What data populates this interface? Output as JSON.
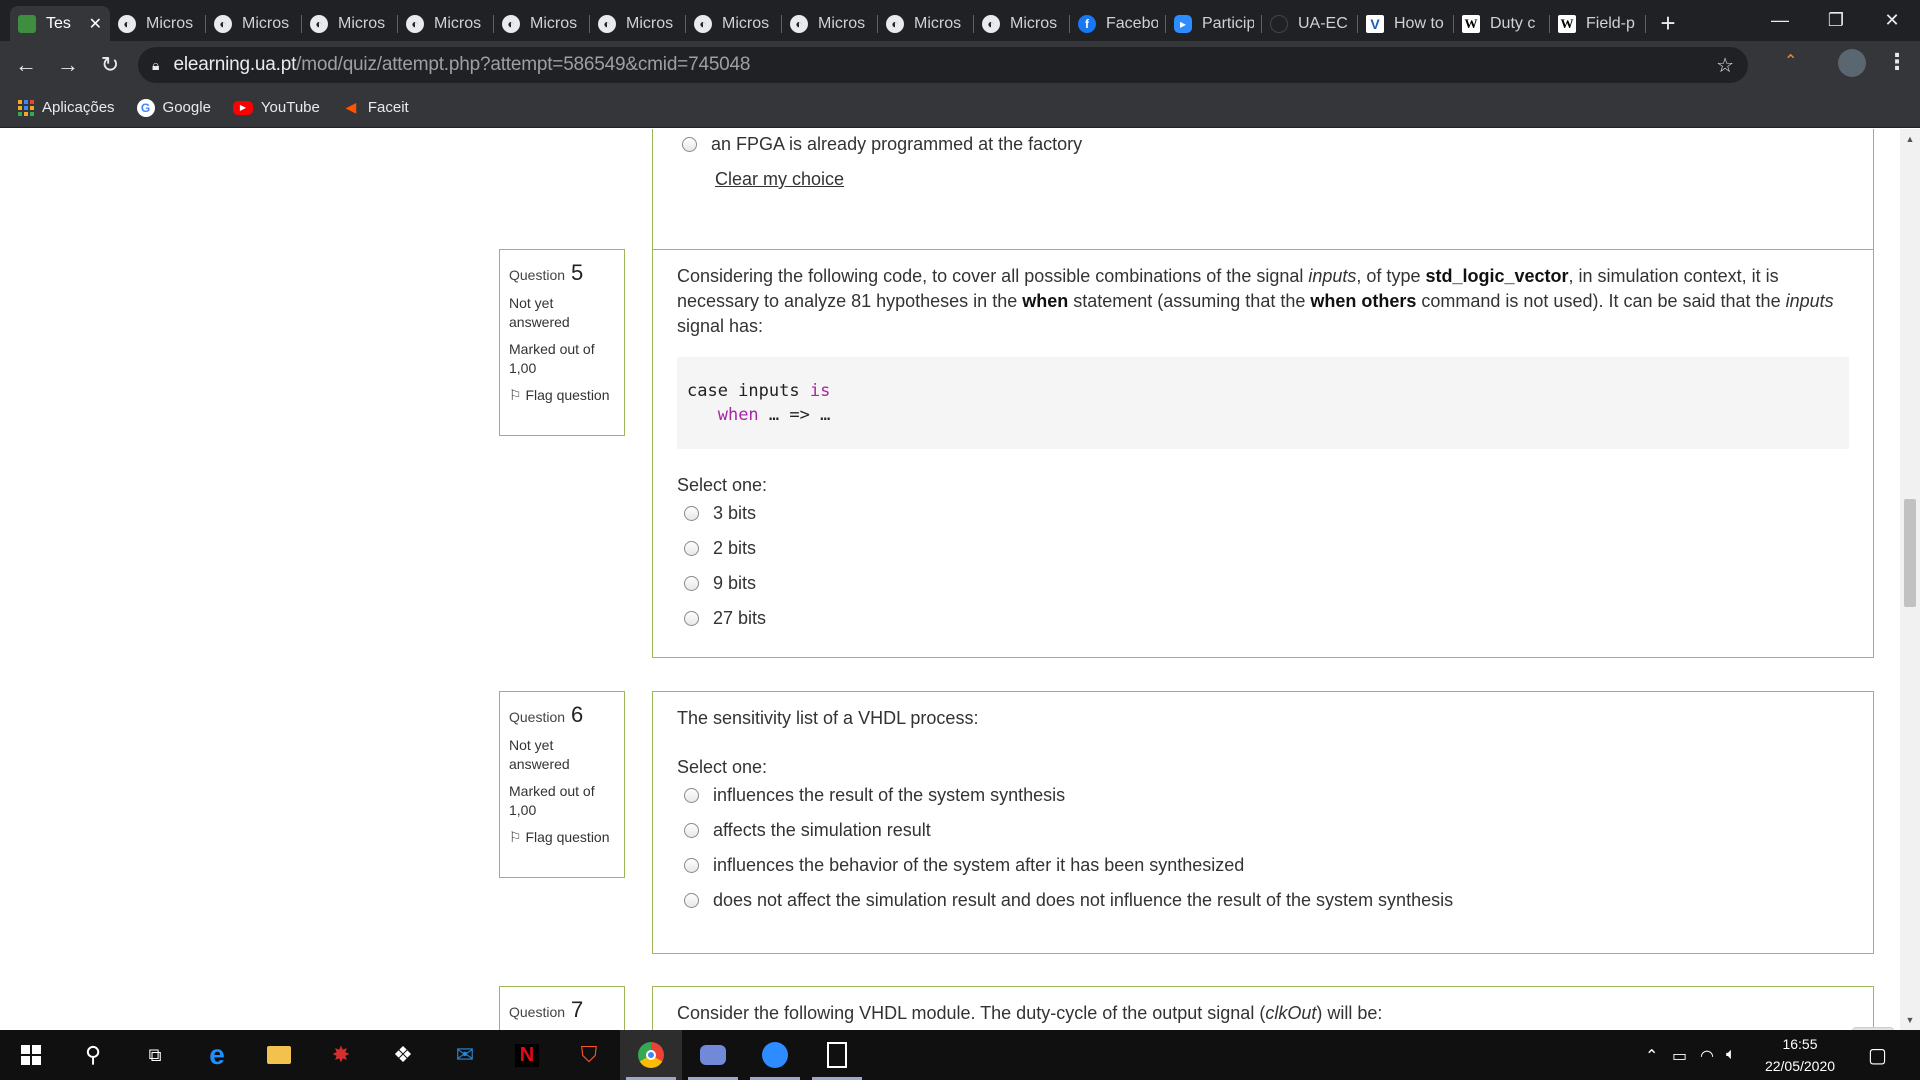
{
  "browser": {
    "tabs": [
      {
        "label": "Tes",
        "icon": "moodle-icon",
        "active": true
      },
      {
        "label": "Micros",
        "icon": "globe-icon"
      },
      {
        "label": "Micros",
        "icon": "globe-icon"
      },
      {
        "label": "Micros",
        "icon": "globe-icon"
      },
      {
        "label": "Micros",
        "icon": "globe-icon"
      },
      {
        "label": "Micros",
        "icon": "globe-icon"
      },
      {
        "label": "Micros",
        "icon": "globe-icon"
      },
      {
        "label": "Micros",
        "icon": "globe-icon"
      },
      {
        "label": "Micros",
        "icon": "globe-icon"
      },
      {
        "label": "Micros",
        "icon": "globe-icon"
      },
      {
        "label": "Micros",
        "icon": "globe-icon"
      },
      {
        "label": "Facebo",
        "icon": "facebook-icon"
      },
      {
        "label": "Particip",
        "icon": "zoom-icon"
      },
      {
        "label": "UA-EC",
        "icon": "ua-icon"
      },
      {
        "label": "How to",
        "icon": "v-icon"
      },
      {
        "label": "Duty c",
        "icon": "w-icon"
      },
      {
        "label": "Field-p",
        "icon": "w-icon"
      }
    ],
    "url_host": "elearning.ua.pt",
    "url_path": "/mod/quiz/attempt.php?attempt=586549&cmid=745048",
    "bookmarks": [
      {
        "label": "Aplicações",
        "icon": "apps-icon"
      },
      {
        "label": "Google",
        "icon": "google-icon"
      },
      {
        "label": "YouTube",
        "icon": "youtube-icon"
      },
      {
        "label": "Faceit",
        "icon": "faceit-icon"
      }
    ]
  },
  "quiz": {
    "prev_option": "an FPGA is already programmed at the factory",
    "clear_choice": "Clear my choice",
    "select_one": "Select one:",
    "question_label": "Question",
    "status": "Not yet answered",
    "marked": "Marked out of 1,00",
    "flag": "Flag question",
    "q5": {
      "number": "5",
      "text_parts": [
        "Considering the following code, to cover all possible combinations of the signal ",
        "inputs",
        ", of type ",
        "std_logic_vector",
        ", in simulation context, it is necessary to analyze 81 hypotheses in the ",
        "when",
        " statement (assuming that the ",
        "when others",
        " command is not used). It can be said that the ",
        "inputs",
        " signal has:"
      ],
      "code_line1": [
        "case inputs ",
        "is"
      ],
      "code_line2": [
        "when",
        " … => …"
      ],
      "options": [
        "3 bits",
        "2 bits",
        "9 bits",
        "27 bits"
      ]
    },
    "q6": {
      "number": "6",
      "text": "The sensitivity list of a VHDL process:",
      "options": [
        "influences the result of the system synthesis",
        "affects the simulation result",
        "influences the behavior of the system after it has been synthesized",
        "does not affect the simulation result and does not influence the result of the system synthesis"
      ]
    },
    "q7": {
      "number": "7",
      "text_parts": [
        "Consider the following VHDL module. The  duty-cycle of the output signal (",
        "clkOut",
        ") will be:"
      ]
    }
  },
  "taskbar": {
    "time": "16:55",
    "date": "22/05/2020"
  }
}
